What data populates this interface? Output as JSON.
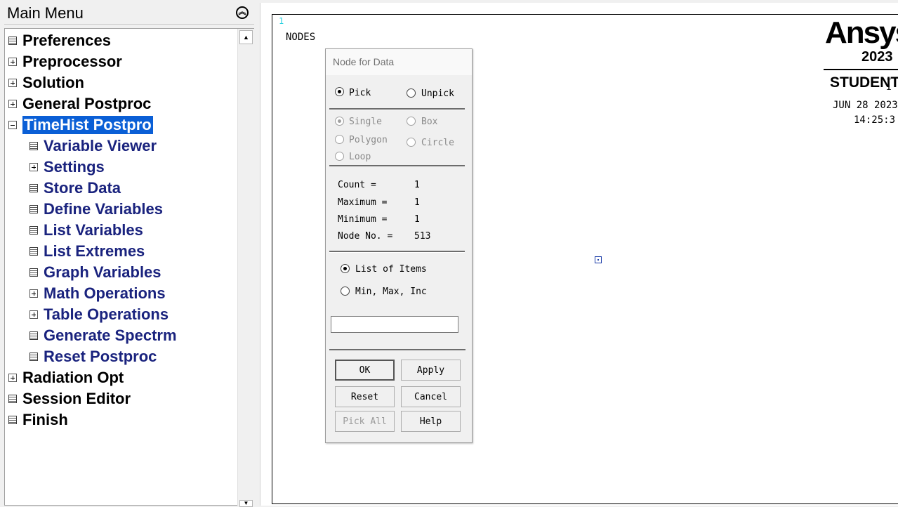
{
  "main_menu": {
    "title": "Main Menu",
    "items": [
      {
        "label": "Preferences",
        "icon": "calc-icon"
      },
      {
        "label": "Preprocessor",
        "icon": "plus-icon"
      },
      {
        "label": "Solution",
        "icon": "plus-icon"
      },
      {
        "label": "General Postproc",
        "icon": "plus-icon"
      },
      {
        "label": "TimeHist Postpro",
        "icon": "minus-icon",
        "selected": true
      },
      {
        "label": "Variable Viewer",
        "icon": "calc-icon"
      },
      {
        "label": "Settings",
        "icon": "plus-icon"
      },
      {
        "label": "Store Data",
        "icon": "calc-icon"
      },
      {
        "label": "Define Variables",
        "icon": "calc-icon"
      },
      {
        "label": "List Variables",
        "icon": "calc-icon"
      },
      {
        "label": "List Extremes",
        "icon": "calc-icon"
      },
      {
        "label": "Graph Variables",
        "icon": "calc-icon"
      },
      {
        "label": "Math Operations",
        "icon": "plus-icon"
      },
      {
        "label": "Table Operations",
        "icon": "plus-icon"
      },
      {
        "label": "Generate Spectrm",
        "icon": "calc-icon"
      },
      {
        "label": "Reset Postproc",
        "icon": "calc-icon"
      },
      {
        "label": "Radiation Opt",
        "icon": "plus-icon"
      },
      {
        "label": "Session Editor",
        "icon": "calc-icon"
      },
      {
        "label": "Finish",
        "icon": "calc-icon"
      }
    ]
  },
  "graphics": {
    "window_number": "1",
    "plot_label": "NODES",
    "logo_text": "Ansys",
    "logo_year": "2023",
    "edition": "STUDENT",
    "date": "JUN 28 2023",
    "time": "14:25:3"
  },
  "dialog": {
    "title": "Node for Data",
    "pick_label": "Pick",
    "unpick_label": "Unpick",
    "single_label": "Single",
    "box_label": "Box",
    "polygon_label": "Polygon",
    "circle_label": "Circle",
    "loop_label": "Loop",
    "count_label": "Count    =",
    "count_value": "1",
    "maximum_label": "Maximum  =",
    "maximum_value": "1",
    "minimum_label": "Minimum  =",
    "minimum_value": "1",
    "node_no_label": "Node No. =",
    "node_no_value": "513",
    "list_of_items_label": "List of Items",
    "min_max_inc_label": "Min, Max, Inc",
    "input_value": "",
    "buttons": {
      "ok": "OK",
      "apply": "Apply",
      "reset": "Reset",
      "cancel": "Cancel",
      "pick_all": "Pick All",
      "help": "Help"
    }
  },
  "colors": {
    "selection": "#0a5fd6",
    "submenu_text": "#1a237e",
    "window_number": "#27d0e0"
  }
}
